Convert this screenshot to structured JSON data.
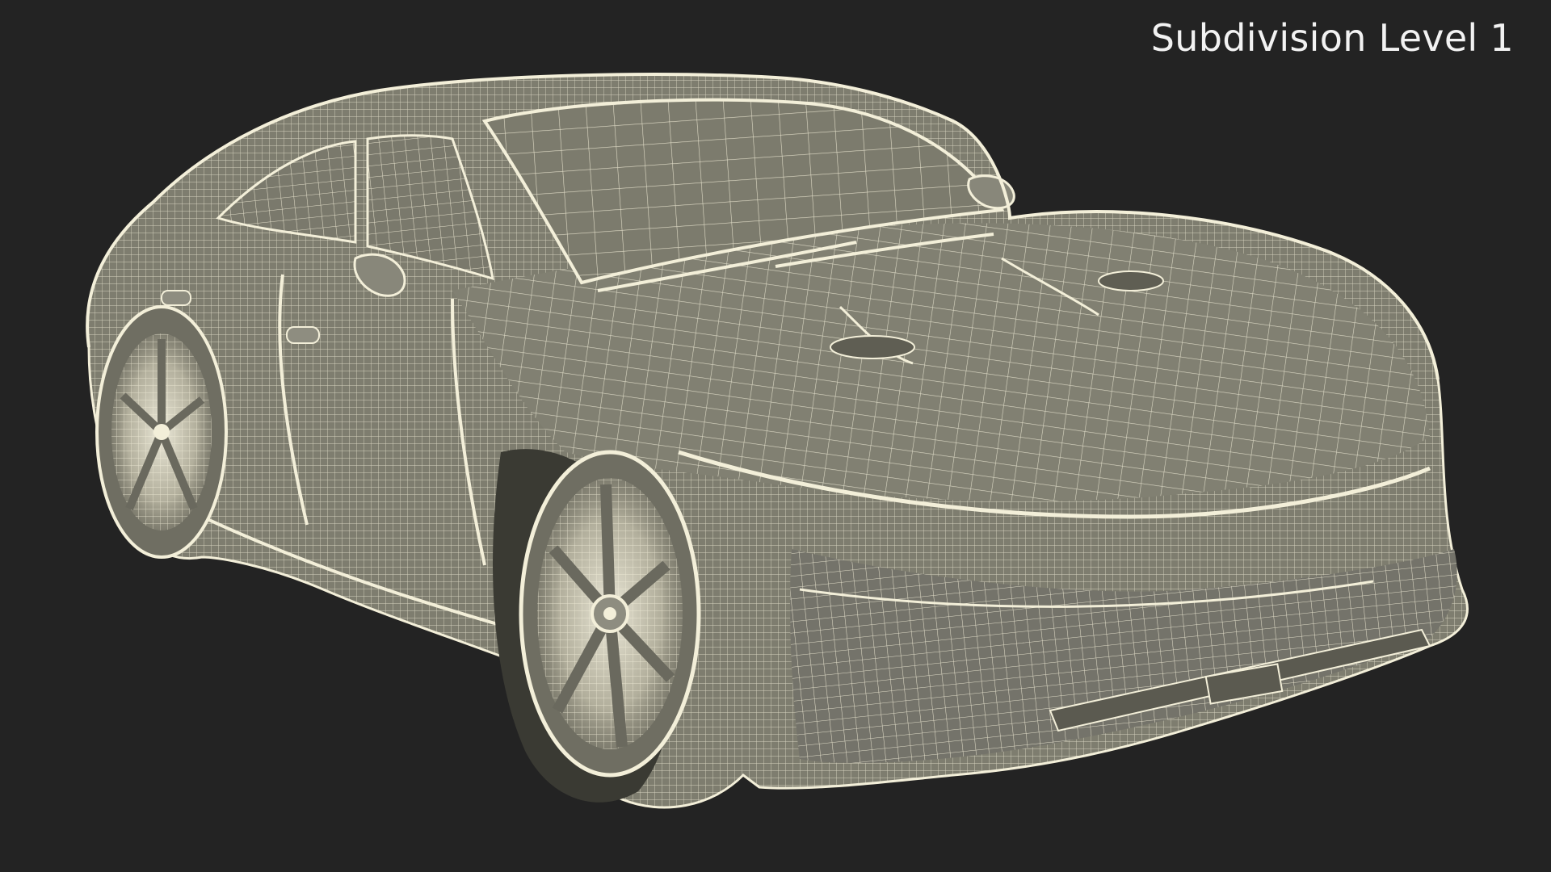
{
  "viewport": {
    "background_color": "#232323",
    "label": "Subdivision Level 1",
    "label_color": "#f2f2f2"
  },
  "model": {
    "subject": "wireframe sports car",
    "surface_color": "#7e7d6f",
    "wire_color": "#f3efd9"
  }
}
